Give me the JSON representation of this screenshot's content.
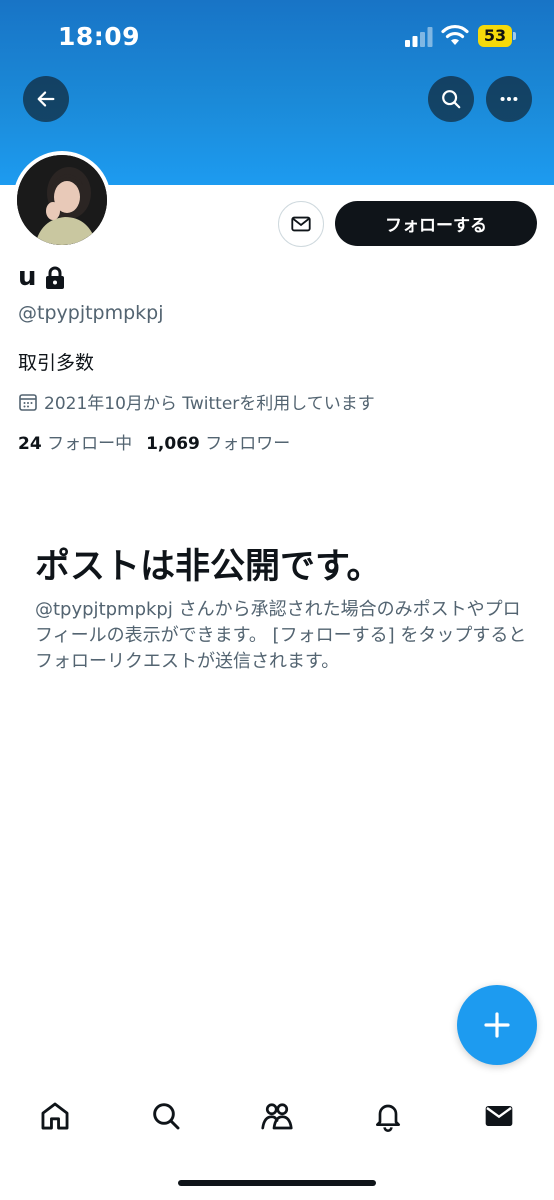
{
  "status_bar": {
    "time": "18:09",
    "battery": "53"
  },
  "colors": {
    "banner": "#1d9bf0",
    "accent": "#1d9bf0",
    "text": "#0f1419",
    "secondary": "#536471",
    "battery": "#f5d90a"
  },
  "header_icons": {
    "back": "arrow-left-icon",
    "search": "search-icon",
    "more": "more-icon"
  },
  "profile": {
    "display_name": "u",
    "handle": "@tpypjtpmpkpj",
    "bio": "取引多数",
    "joined": "2021年10月から Twitterを利用しています",
    "following_count": "24",
    "following_label": "フォロー中",
    "followers_count": "1,069",
    "followers_label": "フォロワー"
  },
  "actions": {
    "follow_label": "フォローする",
    "message_icon": "mail-icon"
  },
  "private_notice": {
    "title": "ポストは非公開です。",
    "description": "@tpypjtpmpkpj さんから承認された場合のみポストやプロフィールの表示ができます。 [フォローする] をタップするとフォローリクエストが送信されます。"
  },
  "fab": {
    "icon": "plus-icon"
  },
  "bottom_nav": [
    "home-icon",
    "search-icon",
    "communities-icon",
    "notifications-icon",
    "messages-icon"
  ]
}
